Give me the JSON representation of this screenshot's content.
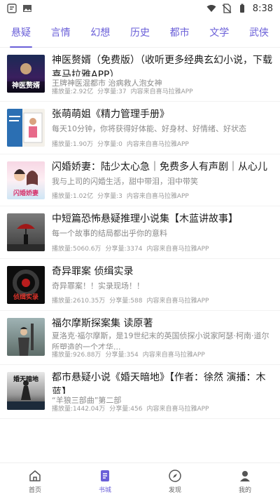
{
  "status_bar": {
    "time": "8:38",
    "icons": [
      "app-notification-icon",
      "image-icon",
      "wifi-icon",
      "no-sim-icon",
      "battery-icon"
    ]
  },
  "tabs": [
    {
      "label": "悬疑",
      "active": true
    },
    {
      "label": "言情"
    },
    {
      "label": "幻想"
    },
    {
      "label": "历史"
    },
    {
      "label": "都市"
    },
    {
      "label": "文学"
    },
    {
      "label": "武侠"
    }
  ],
  "books": [
    {
      "title": "神医赘婿（免费版）（收听更多经典玄幻小说，下载喜马拉雅APP）",
      "desc": "王牌神医混都市 治病救人泡女神",
      "plays": "播放量:2.92亿",
      "shares": "分享量:37",
      "source": "内容来自喜马拉雅APP",
      "cover_text": "神医赘婿"
    },
    {
      "title": "张萌萌姐《精力管理手册》",
      "desc": "每天10分钟，你将获得好体能、好身材、好情绪、好状态",
      "plays": "播放量:1.90万",
      "shares": "分享量:0",
      "source": "内容来自喜马拉雅APP",
      "cover_text": ""
    },
    {
      "title": "闪婚娇妻：陆少太心急｜免费多人有声剧｜从心儿",
      "desc": "我与上司的闪婚生活，甜中带泪，泪中带笑",
      "plays": "播放量:1.02亿",
      "shares": "分享量:3",
      "source": "内容来自喜马拉雅APP",
      "cover_text": "闪婚娇妻"
    },
    {
      "title": "中短篇恐怖悬疑推理小说集【木蓝讲故事】",
      "desc": "每一个故事的结局都出乎你的意料",
      "plays": "播放量:5060.6万",
      "shares": "分享量:3374",
      "source": "内容来自喜马拉雅APP",
      "cover_text": ""
    },
    {
      "title": "奇异罪案 侦缉实录",
      "desc": "奇异罪案！！实录现场！！",
      "plays": "播放量:2610.35万",
      "shares": "分享量:588",
      "source": "内容来自喜马拉雅APP",
      "cover_text": "侦缉实录"
    },
    {
      "title": "福尔摩斯探案集 读原著",
      "desc": "夏洛克·福尔摩斯，是19世纪末的英国侦探小说家阿瑟·柯南·道尔所塑造的一个才华...",
      "plays": "播放量:926.88万",
      "shares": "分享量:354",
      "source": "内容来自喜马拉雅APP",
      "cover_text": ""
    },
    {
      "title": "都市悬疑小说《婚天暗地》【作者：徐然 演播：木蓝】",
      "desc": "“羊狼三部曲”第二部",
      "plays": "播放量:1442.04万",
      "shares": "分享量:456",
      "source": "内容来自喜马拉雅APP",
      "cover_text": "婚天暗地"
    }
  ],
  "bottom_nav": [
    {
      "label": "首页",
      "icon": "home-icon"
    },
    {
      "label": "书城",
      "icon": "book-icon",
      "active": true
    },
    {
      "label": "发现",
      "icon": "compass-icon"
    },
    {
      "label": "我的",
      "icon": "user-icon"
    }
  ],
  "colors": {
    "accent": "#6a5fd8",
    "text": "#1a1a1a",
    "muted": "#8a8a8a"
  }
}
